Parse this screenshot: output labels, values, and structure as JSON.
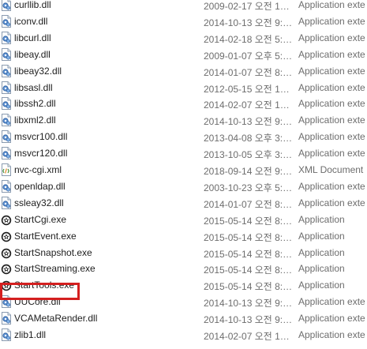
{
  "colors": {
    "highlight": "#d42020",
    "meta_text": "#6d6d6d"
  },
  "files": [
    {
      "name": "curllib.dll",
      "date": "2009-02-17 오전 1…",
      "type": "Application exte",
      "icon": "dll-icon"
    },
    {
      "name": "iconv.dll",
      "date": "2014-10-13 오전 9:…",
      "type": "Application exte",
      "icon": "dll-icon"
    },
    {
      "name": "libcurl.dll",
      "date": "2014-02-18 오전 5:…",
      "type": "Application exte",
      "icon": "dll-icon"
    },
    {
      "name": "libeay.dll",
      "date": "2009-01-07 오후 5:…",
      "type": "Application exte",
      "icon": "dll-icon"
    },
    {
      "name": "libeay32.dll",
      "date": "2014-01-07 오전 8:…",
      "type": "Application exte",
      "icon": "dll-icon"
    },
    {
      "name": "libsasl.dll",
      "date": "2012-05-15 오전 1…",
      "type": "Application exte",
      "icon": "dll-icon"
    },
    {
      "name": "libssh2.dll",
      "date": "2014-02-07 오전 1…",
      "type": "Application exte",
      "icon": "dll-icon"
    },
    {
      "name": "libxml2.dll",
      "date": "2014-10-13 오전 9:…",
      "type": "Application exte",
      "icon": "dll-icon"
    },
    {
      "name": "msvcr100.dll",
      "date": "2013-04-08 오후 3:…",
      "type": "Application exte",
      "icon": "dll-icon"
    },
    {
      "name": "msvcr120.dll",
      "date": "2013-10-05 오후 3:…",
      "type": "Application exte",
      "icon": "dll-icon"
    },
    {
      "name": "nvc-cgi.xml",
      "date": "2018-09-14 오전 9:…",
      "type": "XML Document",
      "icon": "xml-icon"
    },
    {
      "name": "openldap.dll",
      "date": "2003-10-23 오후 5:…",
      "type": "Application exte",
      "icon": "dll-icon"
    },
    {
      "name": "ssleay32.dll",
      "date": "2014-01-07 오전 8:…",
      "type": "Application exte",
      "icon": "dll-icon"
    },
    {
      "name": "StartCgi.exe",
      "date": "2015-05-14 오전 8:…",
      "type": "Application",
      "icon": "exe-icon"
    },
    {
      "name": "StartEvent.exe",
      "date": "2015-05-14 오전 8:…",
      "type": "Application",
      "icon": "exe-icon"
    },
    {
      "name": "StartSnapshot.exe",
      "date": "2015-05-14 오전 8:…",
      "type": "Application",
      "icon": "exe-icon"
    },
    {
      "name": "StartStreaming.exe",
      "date": "2015-05-14 오전 8:…",
      "type": "Application",
      "icon": "exe-icon"
    },
    {
      "name": "StartTools.exe",
      "date": "2015-05-14 오전 8:…",
      "type": "Application",
      "icon": "exe-icon"
    },
    {
      "name": "UUCore.dll",
      "date": "2014-10-13 오전 9:…",
      "type": "Application exte",
      "icon": "dll-icon"
    },
    {
      "name": "VCAMetaRender.dll",
      "date": "2014-10-13 오전 9:…",
      "type": "Application exte",
      "icon": "dll-icon"
    },
    {
      "name": "zlib1.dll",
      "date": "2014-02-07 오전 1…",
      "type": "Application exte",
      "icon": "dll-icon"
    }
  ]
}
